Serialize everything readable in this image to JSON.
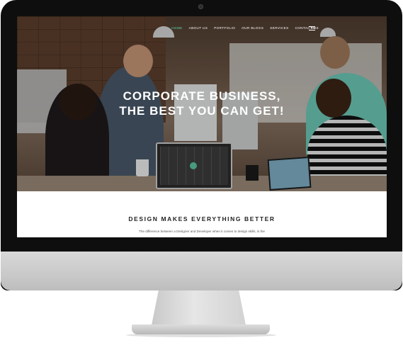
{
  "nav": {
    "items": [
      {
        "label": "HOME",
        "active": true
      },
      {
        "label": "ABOUT US",
        "active": false
      },
      {
        "label": "PORTFOLIO",
        "active": false
      },
      {
        "label": "OUR BLOGS",
        "active": false
      },
      {
        "label": "SERVICES",
        "active": false
      },
      {
        "label": "CONTACT US",
        "active": false
      }
    ],
    "menu_icon": "hamburger-menu-icon"
  },
  "hero": {
    "title_line1": "CORPORATE BUSINESS,",
    "title_line2": "THE BEST YOU CAN GET!"
  },
  "section": {
    "title": "DESIGN MAKES EVERYTHING BETTER",
    "text": "The difference between a Designer and Developer when it comes to design skills, is the"
  },
  "colors": {
    "accent": "#5dd6a8",
    "monitor_bezel": "#0e0e0e",
    "monitor_chin": "#c9c9c9"
  }
}
